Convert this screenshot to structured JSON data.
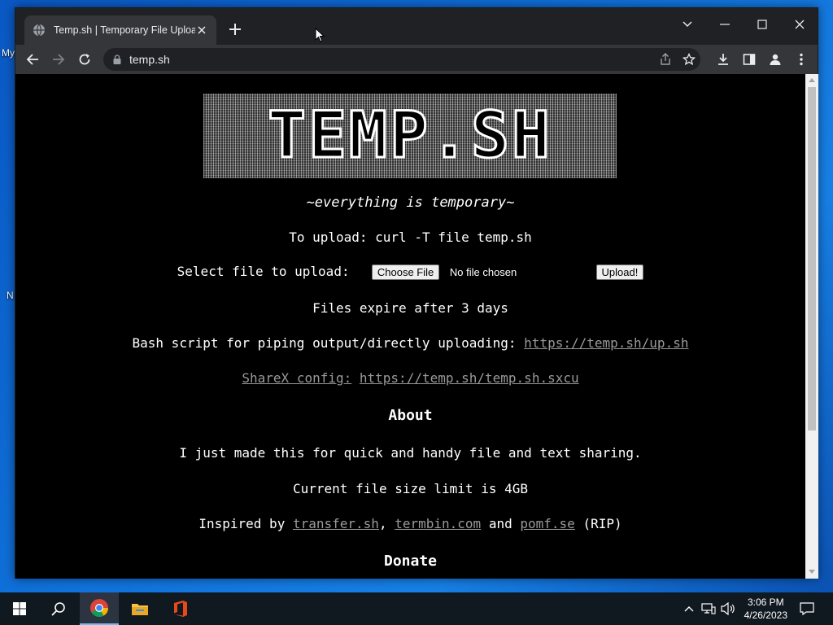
{
  "desktop": {
    "frag1": "My",
    "frag2": "N"
  },
  "browser": {
    "tab_title": "Temp.sh | Temporary File Upload",
    "url": "temp.sh"
  },
  "page": {
    "logo_text": "TEMP.SH",
    "tagline": "~everything is temporary~",
    "upload_cmd": "To upload: curl -T file temp.sh",
    "select_label": "Select file to upload:",
    "choose_file": "Choose File",
    "no_file": "No file chosen",
    "upload_button": "Upload!",
    "expire": "Files expire after 3 days",
    "bash_label": "Bash script for piping output/directly uploading:",
    "bash_link": "https://temp.sh/up.sh",
    "sharex_label": "ShareX config:",
    "sharex_link": "https://temp.sh/temp.sh.sxcu",
    "about_heading": "About",
    "about_text": "I just made this for quick and handy file and text sharing.",
    "size_limit": "Current file size limit is 4GB",
    "inspired_prefix": "Inspired by",
    "inspired_link1": "transfer.sh",
    "inspired_sep1": ",",
    "inspired_link2": "termbin.com",
    "inspired_and": "and",
    "inspired_link3": "pomf.se",
    "inspired_suffix": "(RIP)",
    "donate_heading": "Donate"
  },
  "taskbar": {
    "time": "3:06 PM",
    "date": "4/26/2023"
  },
  "colors": {
    "link": "#9a9a9a",
    "page_bg": "#000000",
    "chrome_dark": "#202124",
    "chrome_tab": "#35363a"
  }
}
